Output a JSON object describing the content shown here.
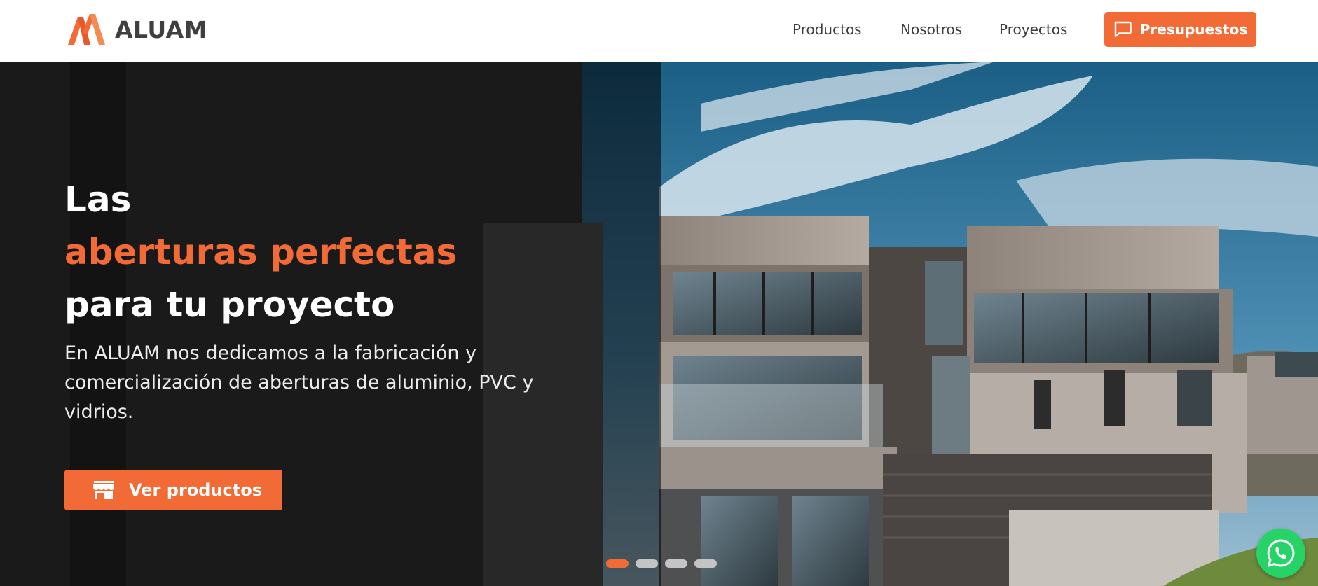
{
  "brand": {
    "name": "ALUAM",
    "logo_icon": "aluam-logo-mark",
    "accent_color": "#f26a36",
    "text_color": "#3f3f3f"
  },
  "nav": {
    "items": [
      {
        "label": "Productos"
      },
      {
        "label": "Nosotros"
      },
      {
        "label": "Proyectos"
      }
    ],
    "cta": {
      "label": "Presupuestos",
      "icon": "chat-bubble-icon"
    }
  },
  "hero": {
    "title_line1": "Las",
    "title_line2": "aberturas perfectas",
    "title_line3": "para tu proyecto",
    "description": "En ALUAM nos dedicamos a la fabricación y comercialización de aberturas de aluminio, PVC y vidrios.",
    "button": {
      "label": "Ver productos",
      "icon": "store-icon"
    },
    "image": "modern-house-photo",
    "slides": {
      "count": 4,
      "active_index": 0
    }
  },
  "whatsapp": {
    "icon": "whatsapp-icon",
    "color": "#25d366"
  }
}
